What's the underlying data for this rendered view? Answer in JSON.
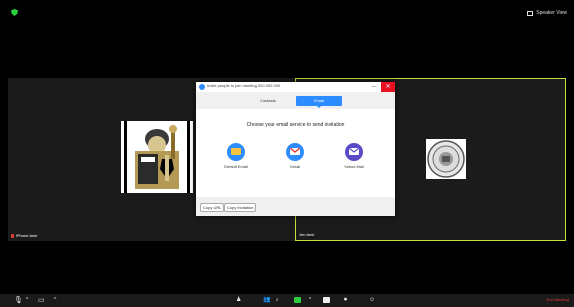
{
  "top_bar": {
    "speaker_view_label": "Speaker View",
    "colors": {
      "shield": "#2ecc40",
      "icon": "#dddddd"
    }
  },
  "gallery": {
    "left_tile": {
      "name": "iPhone Amir",
      "muted": true
    },
    "right_tile": {
      "name": "Jen Amir",
      "active_speaker": true
    },
    "colors": {
      "active_border": "#cddc39",
      "tile_bg": "#1b1b1b"
    }
  },
  "invite_dialog": {
    "title": "Invite people to join meeting 000 000 000",
    "tabs": [
      {
        "label": "Contacts",
        "selected": false
      },
      {
        "label": "Email",
        "selected": true
      }
    ],
    "heading": "Choose your email service to send invitation",
    "services": [
      {
        "label": "Default Email",
        "icon": "default-email-icon"
      },
      {
        "label": "Gmail",
        "icon": "gmail-icon"
      },
      {
        "label": "Yahoo Mail",
        "icon": "yahoo-mail-icon"
      }
    ],
    "buttons": {
      "copy_url": "Copy URL",
      "copy_invitation": "Copy Invitation"
    },
    "close_glyph": "✕",
    "minimize_glyph": "—",
    "colors": {
      "accent": "#2d8cff",
      "close": "#e81123",
      "yahoo": "#5c4bc9"
    }
  },
  "toolbar": {
    "mute_icon": "microphone-icon",
    "video_icon": "video-off-icon",
    "glyphs": {
      "mic": "🎙",
      "caret": "^",
      "video": "▭",
      "participants": "👥",
      "reactions": "☺"
    },
    "participants_count": "2",
    "end_label": "End Meeting",
    "colors": {
      "share": "#2ecc40",
      "end": "#e53935"
    }
  }
}
